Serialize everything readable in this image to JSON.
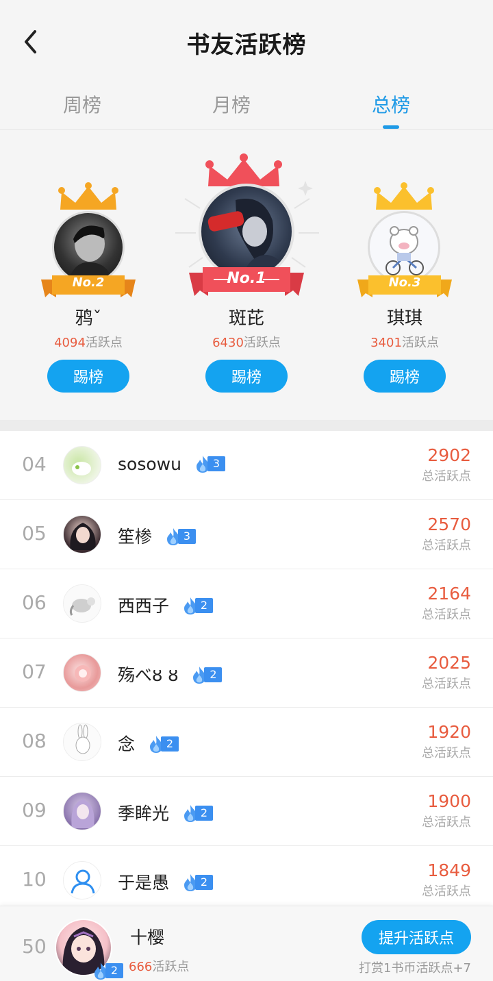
{
  "header": {
    "title": "书友活跃榜"
  },
  "tabs": [
    {
      "label": "周榜",
      "active": false
    },
    {
      "label": "月榜",
      "active": false
    },
    {
      "label": "总榜",
      "active": true
    }
  ],
  "podium": [
    {
      "place": "No.1",
      "name": "斑芘",
      "score": "6430",
      "score_unit": "活跃点",
      "button": "踢榜",
      "crown_color": "#f0505a"
    },
    {
      "place": "No.2",
      "name": "鸦ˇ",
      "score": "4094",
      "score_unit": "活跃点",
      "button": "踢榜",
      "crown_color": "#f5a623"
    },
    {
      "place": "No.3",
      "name": "琪琪",
      "score": "3401",
      "score_unit": "活跃点",
      "button": "踢榜",
      "crown_color": "#fbc02d"
    }
  ],
  "list": [
    {
      "rank": "04",
      "name": "sosowu",
      "level": "3",
      "score": "2902",
      "unit": "总活跃点"
    },
    {
      "rank": "05",
      "name": "笙椮",
      "level": "3",
      "score": "2570",
      "unit": "总活跃点"
    },
    {
      "rank": "06",
      "name": "西西子",
      "level": "2",
      "score": "2164",
      "unit": "总活跃点"
    },
    {
      "rank": "07",
      "name": "殇べȣ ȣ",
      "level": "2",
      "score": "2025",
      "unit": "总活跃点"
    },
    {
      "rank": "08",
      "name": "念",
      "level": "2",
      "score": "1920",
      "unit": "总活跃点"
    },
    {
      "rank": "09",
      "name": "季眸光",
      "level": "2",
      "score": "1900",
      "unit": "总活跃点"
    },
    {
      "rank": "10",
      "name": "于是愚",
      "level": "2",
      "score": "1849",
      "unit": "总活跃点"
    }
  ],
  "me": {
    "rank": "50",
    "name": "十樱",
    "level": "2",
    "score": "666",
    "score_unit": "活跃点",
    "button": "提升活跃点",
    "hint": "打赏1书币活跃点+7"
  },
  "colors": {
    "accent": "#14a3f0",
    "score": "#e85c3f",
    "tab_active": "#1f9ae6"
  }
}
